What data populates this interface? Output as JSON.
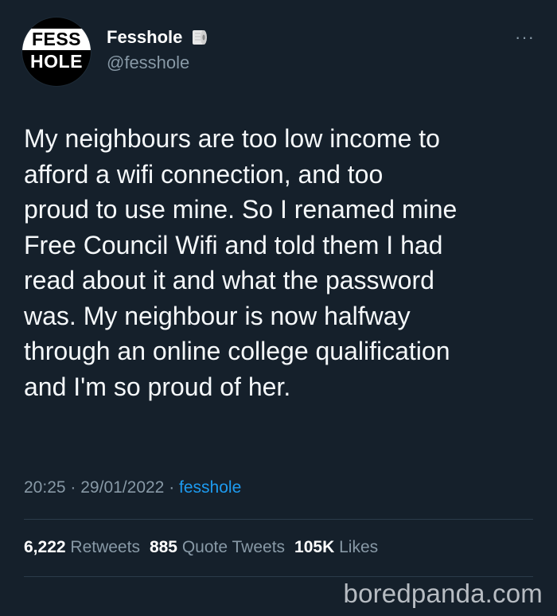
{
  "user": {
    "avatar_line1": "FESS",
    "avatar_line2": "HOLE",
    "display_name": "Fesshole",
    "handle": "@fesshole",
    "badge_icon": "toilet-paper-icon"
  },
  "more_label": "···",
  "tweet": {
    "text": "My neighbours are too low income to\nafford a wifi connection, and too\nproud to use mine. So I renamed mine\nFree Council Wifi and told them I had\nread about it and what the password\nwas. My neighbour is now halfway\nthrough an online college qualification\nand I'm so proud of her."
  },
  "meta": {
    "time": "20:25",
    "separator": "·",
    "date": "29/01/2022",
    "source": "fesshole"
  },
  "stats": {
    "retweets_count": "6,222",
    "retweets_label": "Retweets",
    "quotes_count": "885",
    "quotes_label": "Quote Tweets",
    "likes_count": "105K",
    "likes_label": "Likes"
  },
  "watermark": "boredpanda.com",
  "colors": {
    "background": "#15202b",
    "secondary_text": "#8899a6",
    "link": "#1d9bf0"
  }
}
